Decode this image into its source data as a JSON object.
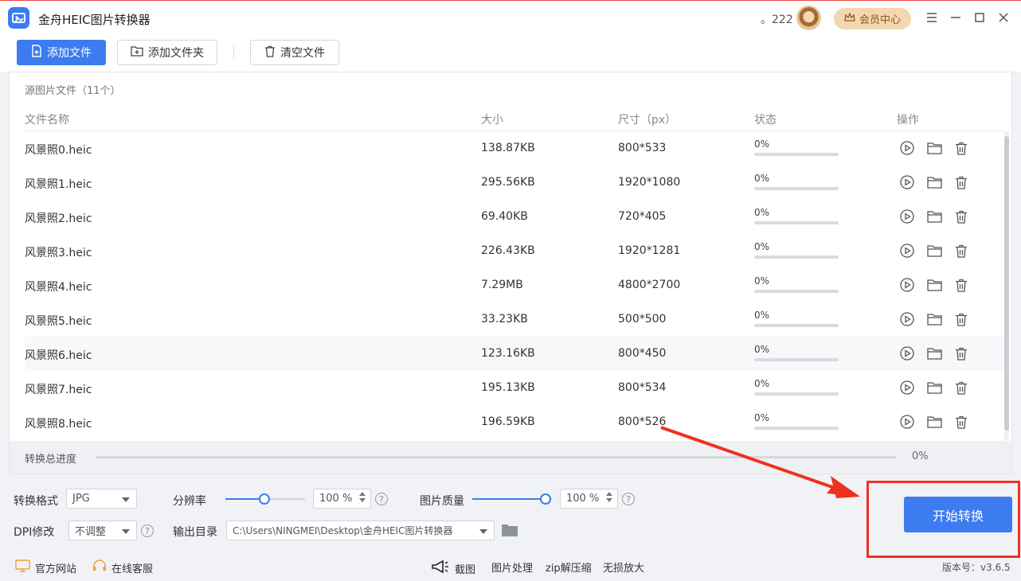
{
  "window": {
    "title": "金舟HEIC图片转换器",
    "points": "。222",
    "vip_label": "会员中心"
  },
  "toolbar": {
    "add_file": "添加文件",
    "add_folder": "添加文件夹",
    "clear_files": "清空文件"
  },
  "source": {
    "title": "源图片文件（11个）",
    "columns": [
      "文件名称",
      "大小",
      "尺寸（px）",
      "状态",
      "操作"
    ],
    "rows": [
      {
        "name": "风景照0.heic",
        "size": "138.87KB",
        "dims": "800*533",
        "status": "0%"
      },
      {
        "name": "风景照1.heic",
        "size": "295.56KB",
        "dims": "1920*1080",
        "status": "0%"
      },
      {
        "name": "风景照2.heic",
        "size": "69.40KB",
        "dims": "720*405",
        "status": "0%"
      },
      {
        "name": "风景照3.heic",
        "size": "226.43KB",
        "dims": "1920*1281",
        "status": "0%"
      },
      {
        "name": "风景照4.heic",
        "size": "7.29MB",
        "dims": "4800*2700",
        "status": "0%"
      },
      {
        "name": "风景照5.heic",
        "size": "33.23KB",
        "dims": "500*500",
        "status": "0%"
      },
      {
        "name": "风景照6.heic",
        "size": "123.16KB",
        "dims": "800*450",
        "status": "0%"
      },
      {
        "name": "风景照7.heic",
        "size": "195.13KB",
        "dims": "800*534",
        "status": "0%"
      },
      {
        "name": "风景照8.heic",
        "size": "196.59KB",
        "dims": "800*526",
        "status": "0%"
      }
    ]
  },
  "progress": {
    "label": "转换总进度",
    "value": "0%"
  },
  "settings": {
    "format_label": "转换格式",
    "format_value": "JPG",
    "resolution_label": "分辨率",
    "resolution_value": "100 %",
    "quality_label": "图片质量",
    "quality_value": "100 %",
    "dpi_label": "DPI修改",
    "dpi_value": "不调整",
    "output_label": "输出目录",
    "output_value": "C:\\Users\\NINGMEI\\Desktop\\金舟HEIC图片转换器",
    "start_button": "开始转换",
    "help_glyph": "?"
  },
  "footer": {
    "website": "官方网站",
    "support": "在线客服",
    "screenshot": "截图",
    "image_process": "图片处理",
    "zip": "zip解压缩",
    "upscale": "无损放大",
    "version": "版本号：v3.6.5"
  },
  "colors": {
    "accent": "#3d7bf0",
    "annotation": "#f0301f"
  }
}
